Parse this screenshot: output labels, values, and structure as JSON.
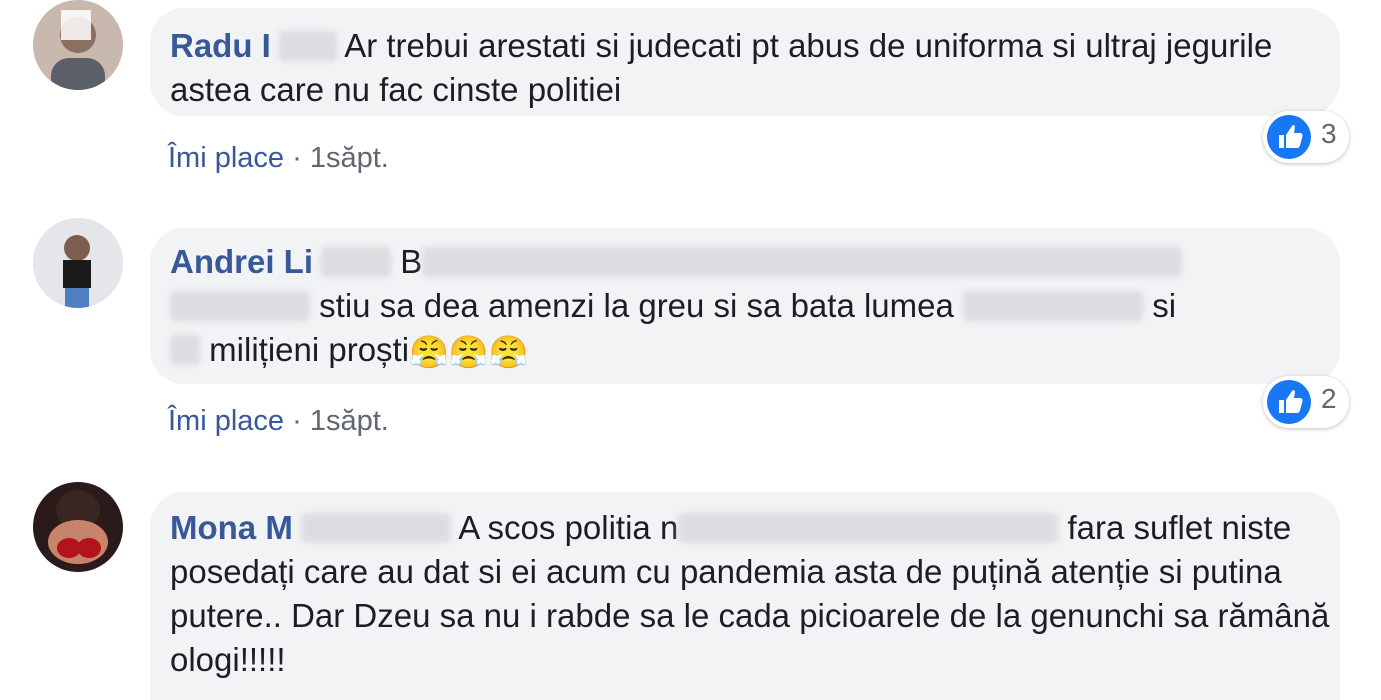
{
  "comments": [
    {
      "author": "Radu I",
      "text": "Ar trebui arestati si judecati pt abus de uniforma si ultraj jegurile astea care nu fac cinste politiei",
      "like_label": "Îmi place",
      "separator": "·",
      "time": "1săpt.",
      "reaction_count": "3"
    },
    {
      "author": "Andrei Li",
      "text_line1": "B",
      "text_line2_a": "stiu sa dea amenzi la greu si sa bata lumea",
      "text_line2_b": "si",
      "text_line3": "milițieni proști",
      "emoji": "😤😤😤",
      "like_label": "Îmi place",
      "separator": "·",
      "time": "1săpt.",
      "reaction_count": "2"
    },
    {
      "author": "Mona M",
      "text_a": "A scos politia n",
      "text_b": "fara suflet niste posedați care au dat si ei acum cu pandemia asta de puțină atenție si putina putere.. Dar Dzeu sa nu i rabde sa le cada picioarele de la genunchi sa rămână ologi!!!!!"
    }
  ],
  "colors": {
    "author": "#385898",
    "text": "#1c1e21",
    "meta": "#606770",
    "bubble": "#f2f3f5",
    "like_blue": "#1877f2"
  },
  "icons": [
    "like-thumb-icon"
  ]
}
